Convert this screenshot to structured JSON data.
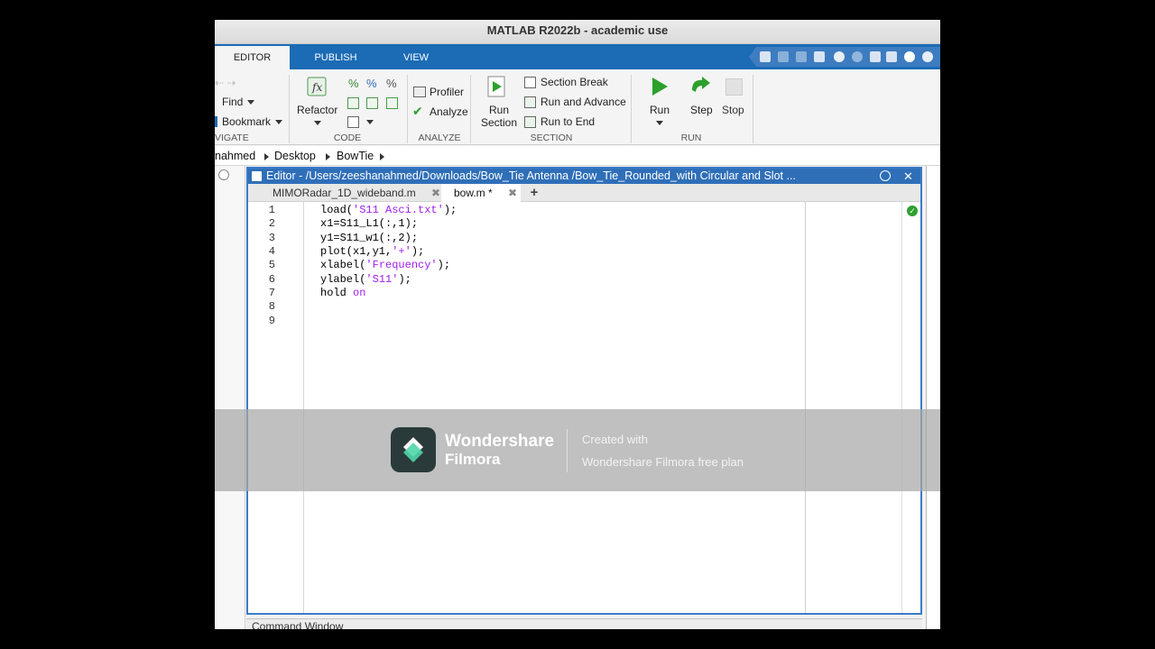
{
  "window": {
    "title": "MATLAB R2022b - academic use"
  },
  "tabs": [
    "EDITOR",
    "PUBLISH",
    "VIEW"
  ],
  "ribbon": {
    "navigate": {
      "find": "Find",
      "bookmark": "Bookmark",
      "label": "VIGATE"
    },
    "code": {
      "refactor": "Refactor",
      "label": "CODE"
    },
    "analyze": {
      "profiler": "Profiler",
      "analyze": "Analyze",
      "label": "ANALYZE"
    },
    "section": {
      "run_section": [
        "Run",
        "Section"
      ],
      "section_break": "Section Break",
      "run_and_advance": "Run and Advance",
      "run_to_end": "Run to End",
      "label": "SECTION"
    },
    "run": {
      "run": "Run",
      "step": "Step",
      "stop": "Stop",
      "label": "RUN"
    }
  },
  "breadcrumb": [
    "nahmed",
    "Desktop",
    "BowTie"
  ],
  "editor": {
    "title": "Editor - /Users/zeeshanahmed/Downloads/Bow_Tie Antenna /Bow_Tie_Rounded_with Circular and Slot ...",
    "tabs": [
      {
        "label": "MIMORadar_1D_wideband.m"
      },
      {
        "label": "bow.m *"
      }
    ],
    "add_tab": "+",
    "line_numbers": [
      "1",
      "2",
      "3",
      "4",
      "5",
      "6",
      "7",
      "8",
      "9"
    ],
    "lines": [
      {
        "parts": [
          {
            "t": "load(",
            "c": ""
          },
          {
            "t": "'S11 Asci.txt'",
            "c": "str"
          },
          {
            "t": ");",
            "c": ""
          }
        ]
      },
      {
        "parts": [
          {
            "t": "x1=S11_L1(:,1);",
            "c": ""
          }
        ]
      },
      {
        "parts": [
          {
            "t": "y1=S11_w1(:,2);",
            "c": ""
          }
        ]
      },
      {
        "parts": [
          {
            "t": "plot(x1,y1,",
            "c": ""
          },
          {
            "t": "'+'",
            "c": "str"
          },
          {
            "t": ");",
            "c": ""
          }
        ]
      },
      {
        "parts": [
          {
            "t": "xlabel(",
            "c": ""
          },
          {
            "t": "'Frequency'",
            "c": "str"
          },
          {
            "t": ");",
            "c": ""
          }
        ]
      },
      {
        "parts": [
          {
            "t": "ylabel(",
            "c": ""
          },
          {
            "t": "'S11'",
            "c": "str"
          },
          {
            "t": ");",
            "c": ""
          }
        ]
      },
      {
        "parts": [
          {
            "t": "hold ",
            "c": ""
          },
          {
            "t": "on",
            "c": "str"
          }
        ]
      },
      {
        "parts": []
      },
      {
        "parts": []
      }
    ]
  },
  "command_window": {
    "label": "Command Window"
  },
  "watermark": {
    "brand1": "Wondershare",
    "brand2": "Filmora",
    "text1": "Created with",
    "text2": "Wondershare Filmora free plan"
  },
  "colors": {
    "accent": "#1b6bb5",
    "editor_border": "#3a7bc8",
    "run_green": "#2ca02c",
    "string": "#a020f0"
  }
}
